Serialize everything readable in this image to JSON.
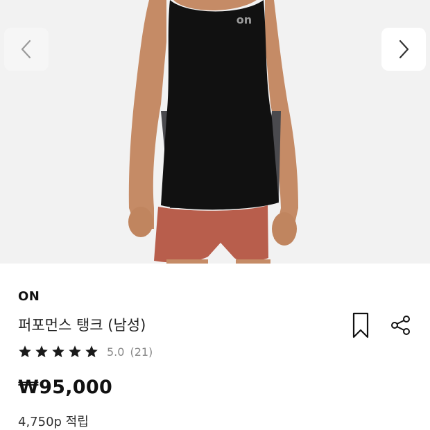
{
  "product": {
    "brand": "ON",
    "title": "퍼포먼스 탱크 (남성)",
    "rating_value": "5.0",
    "review_count": "(21)",
    "price": "₩95,000",
    "points": "4,750p 적립",
    "stars": 5
  },
  "gallery": {
    "prev_icon": "chevron-left-icon",
    "next_icon": "chevron-right-icon",
    "background": "#f2f2f2"
  },
  "actions": {
    "bookmark_icon": "bookmark-icon",
    "share_icon": "share-icon"
  },
  "colors": {
    "tank": "#111111",
    "side_panel": "#4a4a4e",
    "shorts": "#b85e4c",
    "skin": "#c8906a",
    "logo": "#9a9a9a",
    "star": "#1a1a1a"
  }
}
